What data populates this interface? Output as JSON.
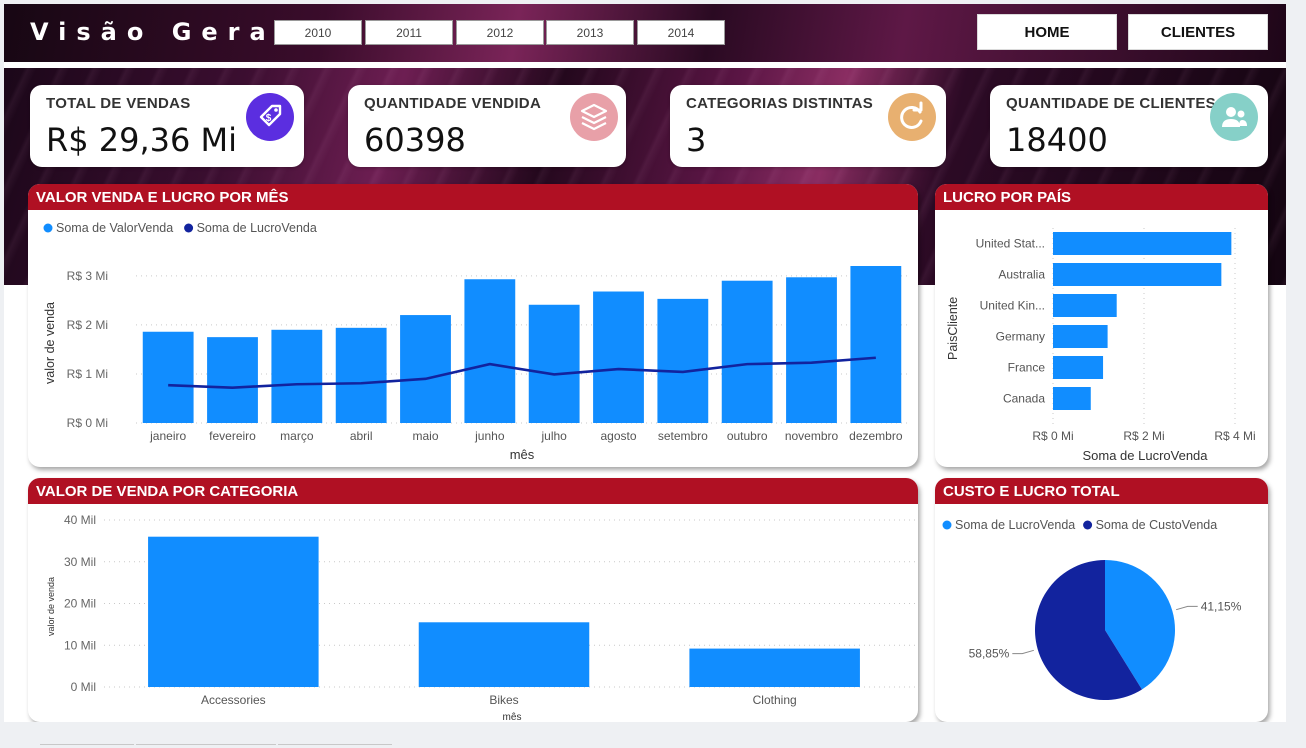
{
  "header": {
    "title": "Visão Geral",
    "years": [
      "2010",
      "2011",
      "2012",
      "2013",
      "2014"
    ],
    "nav": [
      "HOME",
      "CLIENTES"
    ]
  },
  "kpis": [
    {
      "label": "TOTAL DE VENDAS",
      "value": "R$ 29,36 Mi",
      "icon": "price-tag-icon",
      "color": "#5b2ee0"
    },
    {
      "label": "QUANTIDADE VENDIDA",
      "value": "60398",
      "icon": "layers-icon",
      "color": "#e8a0a8"
    },
    {
      "label": "CATEGORIAS DISTINTAS",
      "value": "3",
      "icon": "refresh-icon",
      "color": "#e8b070"
    },
    {
      "label": "QUANTIDADE DE CLIENTES",
      "value": "18400",
      "icon": "users-icon",
      "color": "#86d0c8"
    }
  ],
  "colors": {
    "light_blue": "#118dff",
    "dark_blue": "#12239e",
    "header_red": "#b01023"
  },
  "chart_data": [
    {
      "type": "bar",
      "title": "VALOR VENDA E LUCRO POR MÊS",
      "xlabel": "mês",
      "ylabel": "valor de venda",
      "categories": [
        "janeiro",
        "fevereiro",
        "março",
        "abril",
        "maio",
        "junho",
        "julho",
        "agosto",
        "setembro",
        "outubro",
        "novembro",
        "dezembro"
      ],
      "yticks": [
        "R$ 0 Mi",
        "R$ 1 Mi",
        "R$ 2 Mi",
        "R$ 3 Mi"
      ],
      "ylim": [
        0,
        3.2
      ],
      "legend_position": "top-left",
      "series": [
        {
          "name": "Soma de ValorVenda",
          "kind": "bar",
          "color": "#118dff",
          "values": [
            1.86,
            1.75,
            1.9,
            1.94,
            2.2,
            2.93,
            2.41,
            2.68,
            2.53,
            2.9,
            2.97,
            3.2
          ]
        },
        {
          "name": "Soma de LucroVenda",
          "kind": "line",
          "color": "#12239e",
          "values": [
            0.77,
            0.72,
            0.79,
            0.81,
            0.9,
            1.2,
            0.99,
            1.1,
            1.04,
            1.2,
            1.23,
            1.33
          ]
        }
      ]
    },
    {
      "type": "bar",
      "orientation": "horizontal",
      "title": "LUCRO POR PAÍS",
      "xlabel": "Soma de LucroVenda",
      "ylabel": "PaisCliente",
      "categories": [
        "United Stat...",
        "Australia",
        "United Kin...",
        "Germany",
        "France",
        "Canada"
      ],
      "values": [
        3.92,
        3.7,
        1.4,
        1.2,
        1.1,
        0.83
      ],
      "xticks": [
        "R$ 0 Mi",
        "R$ 2 Mi",
        "R$ 4 Mi"
      ],
      "xlim": [
        0,
        4
      ]
    },
    {
      "type": "bar",
      "title": "VALOR DE VENDA POR CATEGORIA",
      "xlabel": "mês",
      "ylabel": "valor de venda",
      "categories": [
        "Accessories",
        "Bikes",
        "Clothing"
      ],
      "values": [
        36,
        15.5,
        9.2
      ],
      "yticks": [
        "0 Mil",
        "10 Mil",
        "20 Mil",
        "30 Mil",
        "40 Mil"
      ],
      "ylim": [
        0,
        40
      ]
    },
    {
      "type": "pie",
      "title": "CUSTO E LUCRO TOTAL",
      "legend_position": "top-left",
      "slices": [
        {
          "name": "Soma de LucroVenda",
          "value": 41.15,
          "label": "41,15%",
          "color": "#118dff"
        },
        {
          "name": "Soma de CustoVenda",
          "value": 58.85,
          "label": "58,85%",
          "color": "#12239e"
        }
      ]
    }
  ]
}
